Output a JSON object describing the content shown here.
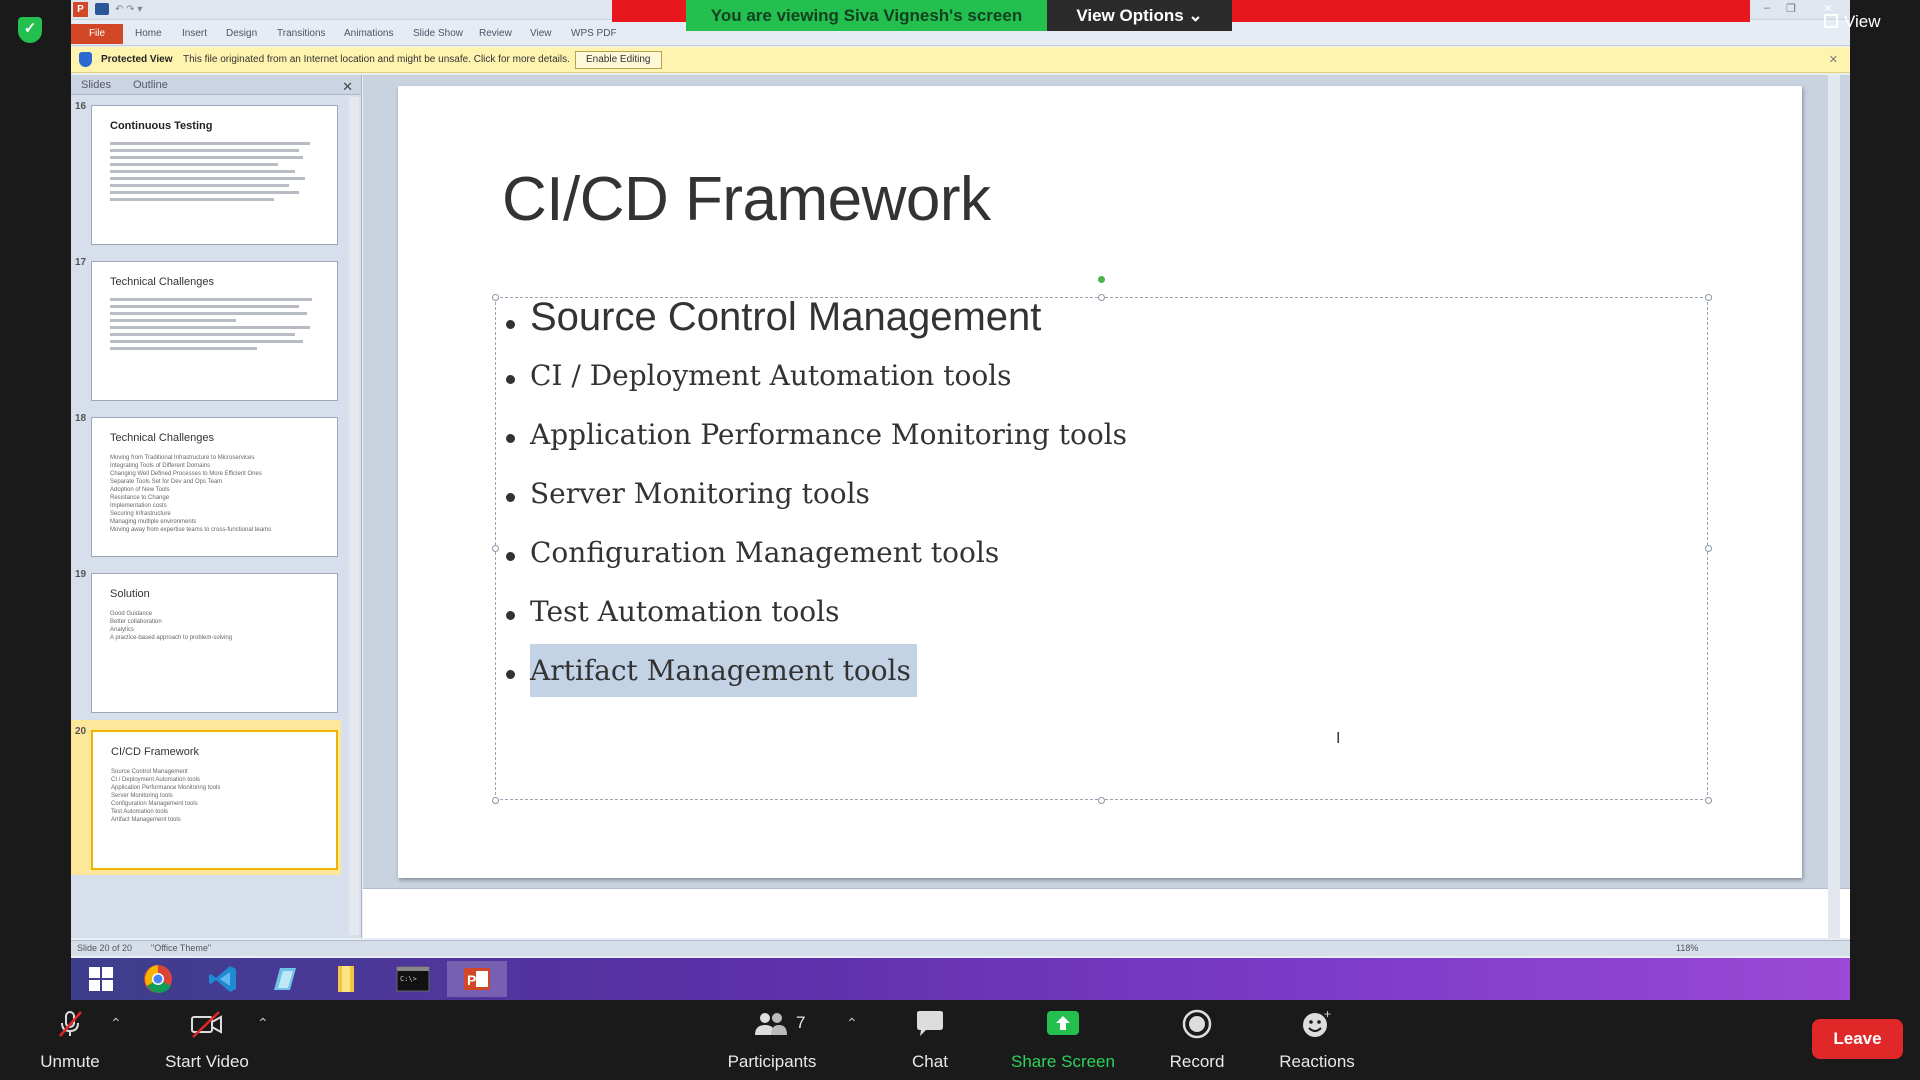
{
  "share_banner": {
    "viewing_text": "You are viewing Siva Vignesh's screen",
    "view_options": "View Options",
    "view_label": "View"
  },
  "ppt": {
    "ribbon_tabs": [
      "File",
      "Home",
      "Insert",
      "Design",
      "Transitions",
      "Animations",
      "Slide Show",
      "Review",
      "View",
      "WPS PDF"
    ],
    "protected": {
      "label": "Protected View",
      "message": "This file originated from an Internet location and might be unsafe. Click for more details.",
      "button": "Enable Editing"
    },
    "pane_tabs": [
      "Slides",
      "Outline"
    ],
    "thumbnails": [
      {
        "num": "16",
        "title": "Continuous  Testing"
      },
      {
        "num": "17",
        "title": "Technical  Challenges"
      },
      {
        "num": "18",
        "title": "Technical  Challenges",
        "items": [
          "Moving from Traditional Infrastructure to Microservices",
          "Integrating Tools of Different Domains",
          "Changing Well Defined Processes to More Efficient Ones",
          "Separate Tools Set for Dev and Ops Team",
          "Adoption of New Tools",
          "Resistance to Change",
          "Implementation costs",
          "Securing Infrastructure",
          "Managing multiple environments",
          "Moving away from expertise teams to cross-functional teams"
        ]
      },
      {
        "num": "19",
        "title": "Solution",
        "items": [
          "Good Guidance",
          "Better collaboration",
          "Analytics",
          "A practice-based approach to problem-solving"
        ]
      },
      {
        "num": "20",
        "title": "CI/CD Framework",
        "items": [
          "Source Control Management",
          "CI / Deployment Automation tools",
          "Application Performance Monitoring tools",
          "Server Monitoring tools",
          "Configuration Management tools",
          "Test Automation tools",
          "Artifact Management tools"
        ]
      }
    ],
    "slide": {
      "title": "CI/CD Framework",
      "bullets": [
        "Source Control Management",
        "CI / Deployment Automation tools",
        "Application Performance Monitoring tools",
        "Server Monitoring tools",
        "Configuration Management tools",
        "Test Automation tools",
        "Artifact Management tools"
      ]
    },
    "status": {
      "slide_counter": "Slide 20 of 20",
      "theme": "\"Office Theme\"",
      "zoom": "118%"
    }
  },
  "zoom_toolbar": {
    "unmute": "Unmute",
    "start_video": "Start Video",
    "participants": "Participants",
    "participant_count": "7",
    "chat": "Chat",
    "share_screen": "Share Screen",
    "record": "Record",
    "reactions": "Reactions",
    "leave": "Leave"
  },
  "colors": {
    "banner_green": "#23c050",
    "leave_red": "#e02828",
    "file_tab": "#d24726",
    "selection": "#c3d3e5"
  }
}
